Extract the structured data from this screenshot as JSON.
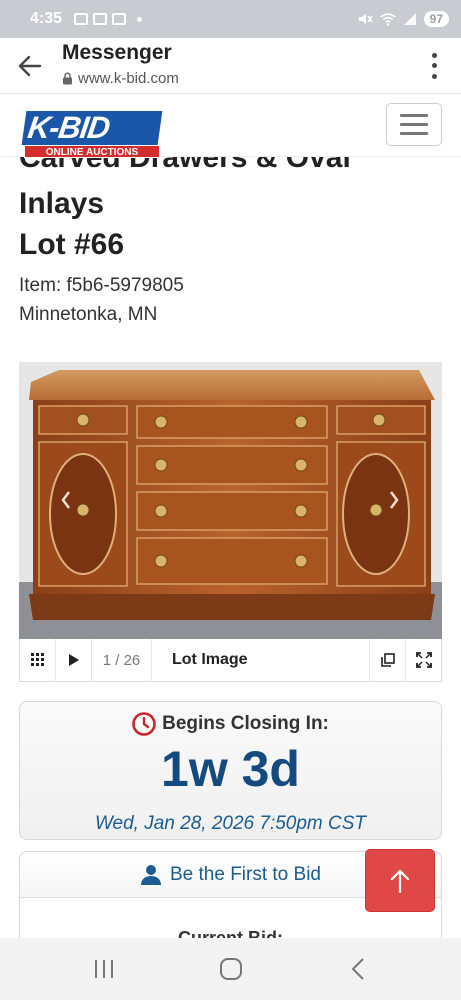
{
  "status_bar": {
    "time": "4:35",
    "battery": "97"
  },
  "browser": {
    "title": "Messenger",
    "url": "www.k-bid.com"
  },
  "site": {
    "logo_text": "K-BID",
    "logo_subtext": "ONLINE AUCTIONS"
  },
  "lot": {
    "title_partial": "Carved Drawers & Oval",
    "title_line2": "Inlays",
    "lot_number": "Lot #66",
    "item_id": "Item: f5b6-5979805",
    "location": "Minnetonka, MN"
  },
  "gallery": {
    "counter": "1 / 26",
    "caption": "Lot Image"
  },
  "closing": {
    "label": "Begins Closing In:",
    "time_left": "1w 3d",
    "date": "Wed, Jan 28, 2026 7:50pm CST"
  },
  "bid": {
    "first_bid_label": "Be the First to Bid",
    "current_bid_label": "Current Bid:"
  },
  "colors": {
    "accent_blue": "#154a80",
    "link_blue": "#1b5c93",
    "logo_blue": "#1b57a8",
    "logo_red": "#d32d2d",
    "scroll_button_red": "#e04848"
  },
  "icons": {
    "back": "back-arrow-icon",
    "lock": "lock-icon",
    "menu": "more-vertical-icon",
    "hamburger": "hamburger-menu-icon",
    "clock": "clock-icon",
    "user": "user-icon",
    "scroll_top": "arrow-up-icon"
  }
}
